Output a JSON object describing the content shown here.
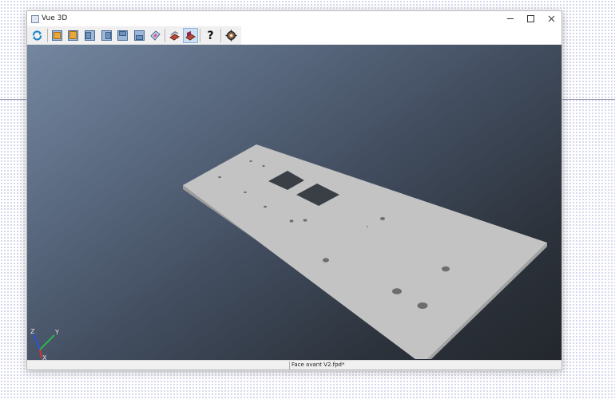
{
  "window": {
    "title": "Vue 3D",
    "controls": {
      "minimize": "minimize",
      "maximize": "maximize",
      "close": "close"
    }
  },
  "toolbar": {
    "buttons": [
      {
        "name": "refresh",
        "icon": "refresh-icon"
      },
      {
        "name": "view-1",
        "icon": "cube-view-icon"
      },
      {
        "name": "view-2",
        "icon": "cube-view-icon"
      },
      {
        "name": "view-3",
        "icon": "cube-view-icon"
      },
      {
        "name": "view-4",
        "icon": "cube-view-icon"
      },
      {
        "name": "view-5",
        "icon": "cube-view-icon"
      },
      {
        "name": "view-6",
        "icon": "cube-view-icon"
      },
      {
        "name": "view-iso",
        "icon": "iso-view-icon"
      },
      {
        "name": "render-1",
        "icon": "render-icon"
      },
      {
        "name": "render-2",
        "icon": "render-icon",
        "pressed": true
      },
      {
        "name": "help",
        "icon": "help-icon",
        "label": "?"
      },
      {
        "name": "settings",
        "icon": "gear-icon"
      }
    ]
  },
  "axes": {
    "x": "X",
    "y": "Y",
    "z": "Z"
  },
  "status": {
    "file": "Face avant V2.fpd*"
  },
  "colors": {
    "viewport_top": "#7487a0",
    "viewport_bottom": "#23272d",
    "panel": "#c3c3c3",
    "panel_edge": "#a9a9a9",
    "axis_x": "#e03030",
    "axis_y": "#2fb24a",
    "axis_z": "#2a52d8"
  }
}
